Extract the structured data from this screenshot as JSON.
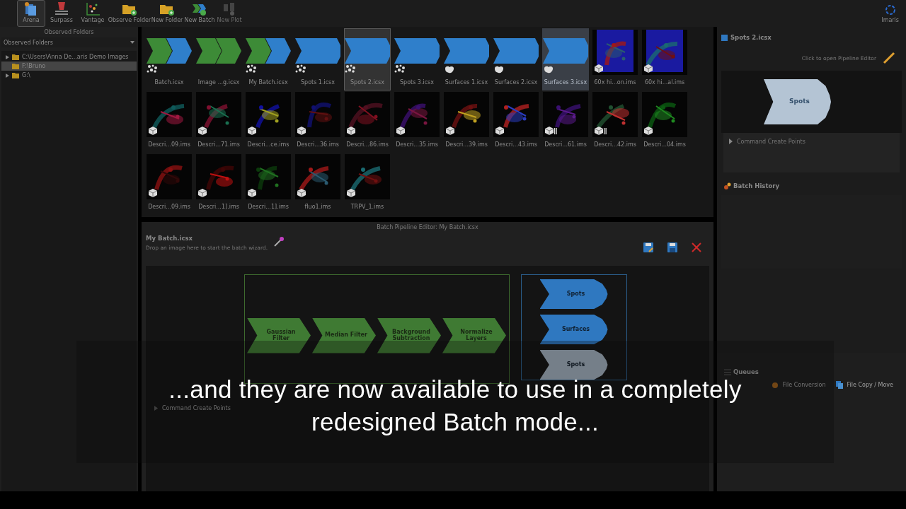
{
  "toolbar": {
    "buttons": [
      {
        "label": "Arena",
        "kind": "arena",
        "selected": true,
        "disabled": false
      },
      {
        "label": "Surpass",
        "kind": "surpass",
        "selected": false,
        "disabled": false
      },
      {
        "label": "Vantage",
        "kind": "vantage",
        "selected": false,
        "disabled": false
      },
      {
        "label": "Observe Folder",
        "kind": "observe",
        "selected": false,
        "disabled": false
      },
      {
        "label": "New Folder",
        "kind": "folder",
        "selected": false,
        "disabled": false
      },
      {
        "label": "New Batch",
        "kind": "batch",
        "selected": false,
        "disabled": false
      },
      {
        "label": "New Plot",
        "kind": "plot",
        "selected": false,
        "disabled": true
      }
    ],
    "app_label": "Imaris"
  },
  "left_panel": {
    "title": "Observed Folders",
    "dropdown": "Observed Folders",
    "folders": [
      {
        "label": "C:\\Users\\Anna De...aris Demo Images",
        "expandable": true,
        "selected": false
      },
      {
        "label": "F:\\Bruno",
        "expandable": false,
        "selected": true
      },
      {
        "label": "G:\\",
        "expandable": true,
        "selected": false
      }
    ]
  },
  "files": [
    {
      "kind": "spots_batch",
      "label": "Batch.icsx",
      "stages": [
        {
          "color": "#3d8b37"
        },
        {
          "color": "#2f7fcb"
        }
      ],
      "selected": false,
      "hovered": false
    },
    {
      "kind": "batch",
      "label": "Image ...g.icsx",
      "stages": [
        {
          "color": "#3d8b37"
        },
        {
          "color": "#3d8b37"
        }
      ],
      "selected": false,
      "hovered": false
    },
    {
      "kind": "spots_batch",
      "label": "My Batch.icsx",
      "stages": [
        {
          "color": "#3d8b37"
        },
        {
          "color": "#2f7fcb"
        }
      ],
      "selected": false,
      "hovered": false
    },
    {
      "kind": "spots_batch",
      "label": "Spots 1.icsx",
      "stages": [
        {
          "color": "#2f7fcb"
        }
      ],
      "selected": false,
      "hovered": false
    },
    {
      "kind": "spots_batch",
      "label": "Spots 2.icsx",
      "stages": [
        {
          "color": "#2f7fcb"
        }
      ],
      "selected": true,
      "hovered": false
    },
    {
      "kind": "spots_batch",
      "label": "Spots 3.icsx",
      "stages": [
        {
          "color": "#2f7fcb"
        }
      ],
      "selected": false,
      "hovered": false
    },
    {
      "kind": "surfaces_batch",
      "label": "Surfaces 1.icsx",
      "stages": [
        {
          "color": "#2f7fcb"
        }
      ],
      "selected": false,
      "hovered": false
    },
    {
      "kind": "surfaces_batch",
      "label": "Surfaces 2.icsx",
      "stages": [
        {
          "color": "#2f7fcb"
        }
      ],
      "selected": false,
      "hovered": false
    },
    {
      "kind": "surfaces_batch",
      "label": "Surfaces 3.icsx",
      "stages": [
        {
          "color": "#2f7fcb"
        }
      ],
      "selected": false,
      "hovered": true
    },
    {
      "label": "60x hi...on.ims",
      "selected": false,
      "hovered": false
    },
    {
      "label": "60x hi...al.ims",
      "selected": false,
      "hovered": false
    },
    {
      "label": "Descri...09.ims",
      "selected": false,
      "hovered": false
    },
    {
      "label": "Descri...71.ims",
      "selected": false,
      "hovered": false
    },
    {
      "label": "Descri...ce.ims",
      "selected": false,
      "hovered": false
    },
    {
      "label": "Descri...36.ims",
      "selected": false,
      "hovered": false
    },
    {
      "label": "Descri...86.ims",
      "selected": false,
      "hovered": false
    },
    {
      "label": "Descri...35.ims",
      "selected": false,
      "hovered": false
    },
    {
      "label": "Descri...39.ims",
      "selected": false,
      "hovered": false
    },
    {
      "label": "Descri...43.ims",
      "selected": false,
      "hovered": false
    },
    {
      "kind": "series",
      "label": "Descri...61.ims",
      "selected": false,
      "hovered": false
    },
    {
      "kind": "series",
      "label": "Descri...42.ims",
      "selected": false,
      "hovered": false
    },
    {
      "label": "Descri...04.ims",
      "selected": false,
      "hovered": false
    },
    {
      "label": "Descri...09.ims",
      "selected": false,
      "hovered": false
    },
    {
      "label": "Descri...1].ims",
      "selected": false,
      "hovered": false
    },
    {
      "label": "Descri...1].ims",
      "selected": false,
      "hovered": false
    },
    {
      "label": "fluo1.ims",
      "selected": false,
      "hovered": false
    },
    {
      "label": "TRPV_1.ims",
      "selected": false,
      "hovered": false
    }
  ],
  "editor": {
    "title": "Batch Pipeline Editor: My Batch.icsx",
    "name": "My Batch.icsx",
    "hint": "Drop an image here to start the batch wizard.",
    "groups": [
      {
        "kind": "processing",
        "stages": [
          {
            "label": "Gaussian Filter",
            "disabled": false
          },
          {
            "label": "Median Filter",
            "disabled": false
          },
          {
            "label": "Background Subtraction",
            "disabled": false
          },
          {
            "label": "Normalize Layers",
            "disabled": false
          }
        ]
      },
      {
        "kind": "detection",
        "stages": [
          {
            "label": "Spots",
            "disabled": false
          },
          {
            "label": "Surfaces",
            "disabled": false
          },
          {
            "label": "Spots",
            "disabled": true
          }
        ]
      }
    ],
    "command": "Command Create Points"
  },
  "right_panel": {
    "title": "Spots 2.icsx",
    "link": "Click to open Pipeline Editor",
    "stage": "Spots",
    "command": "Command Create Points",
    "history_title": "Batch History",
    "queues_title": "Queues",
    "queues": [
      {
        "label": "File Conversion",
        "kind": "conversion"
      },
      {
        "label": "File Copy / Move",
        "kind": "copy"
      }
    ]
  },
  "subtitle": {
    "lines": [
      "...and they are now available to use in a completely",
      "redesigned Batch mode..."
    ]
  }
}
